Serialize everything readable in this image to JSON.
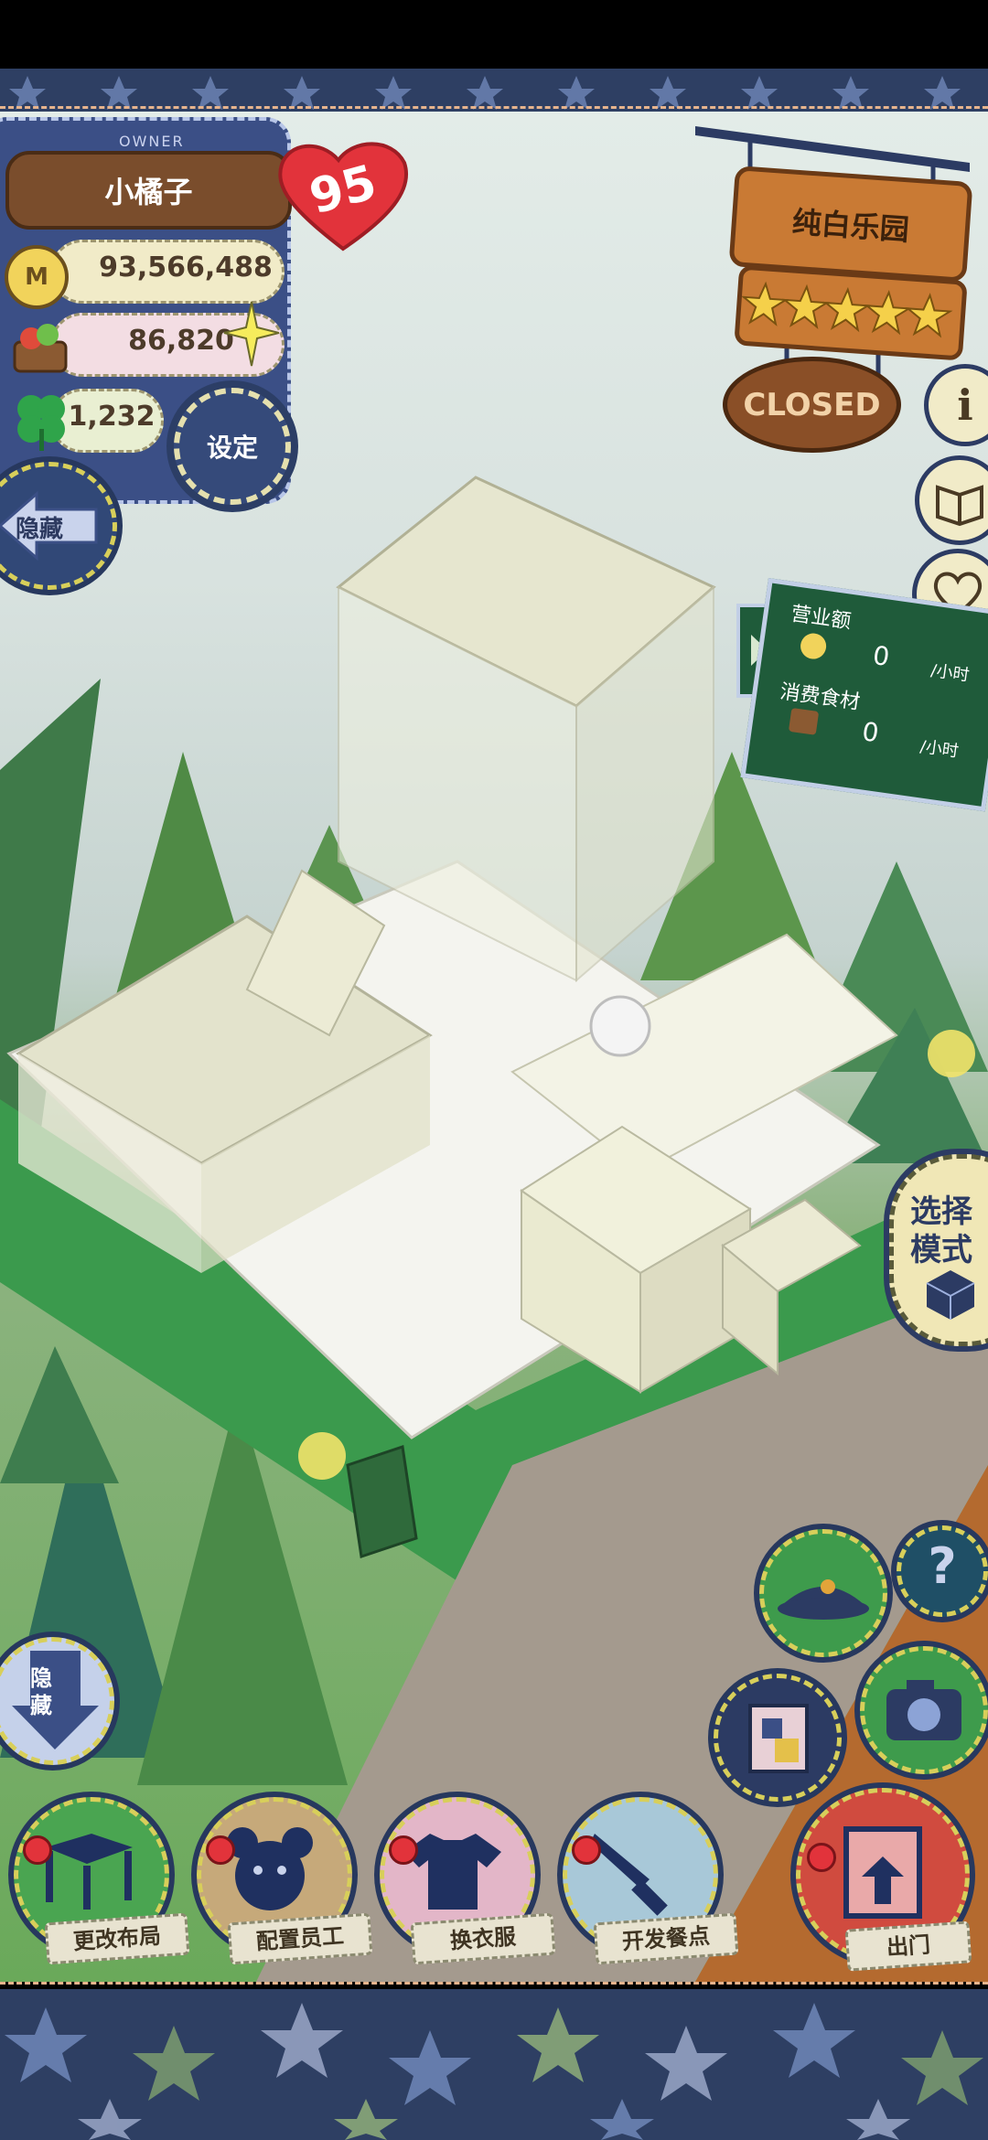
{
  "player": {
    "owner_tag": "OWNER",
    "name": "小橘子",
    "level": "95",
    "coins": "93,566,488",
    "ingredients": "86,820",
    "clovers": "1,232",
    "settings_label": "设定",
    "hide_label": "隐藏"
  },
  "shop_sign": {
    "name": "纯白乐园",
    "stars": 5,
    "status": "CLOSED"
  },
  "stats_board": {
    "revenue_label": "营业额",
    "revenue_value": "0",
    "revenue_unit": "/小时",
    "ingredient_label": "消费食材",
    "ingredient_value": "0",
    "ingredient_unit": "/小时"
  },
  "mode_button": {
    "label_line1": "选择",
    "label_line2": "模式"
  },
  "bottom_hide": {
    "line1": "隐",
    "line2": "藏"
  },
  "bottom_menu": [
    {
      "label": "更改布局",
      "icon": "table-icon"
    },
    {
      "label": "配置员工",
      "icon": "bear-icon"
    },
    {
      "label": "换衣服",
      "icon": "shirt-icon"
    },
    {
      "label": "开发餐点",
      "icon": "knife-icon"
    },
    {
      "label": "出门",
      "icon": "door-icon"
    }
  ],
  "side_icons": [
    "info-icon",
    "recipe-book-icon",
    "heart-letter-icon"
  ],
  "right_tools": [
    "hat-icon",
    "help-icon",
    "album-icon",
    "camera-icon"
  ],
  "help_glyph": "?",
  "info_glyph": "i",
  "colors": {
    "denim": "#3b4f86",
    "wood": "#b9692f",
    "board_green": "#1f5b3a",
    "heart_red": "#e2333b",
    "border_navy": "#2e3f63"
  }
}
